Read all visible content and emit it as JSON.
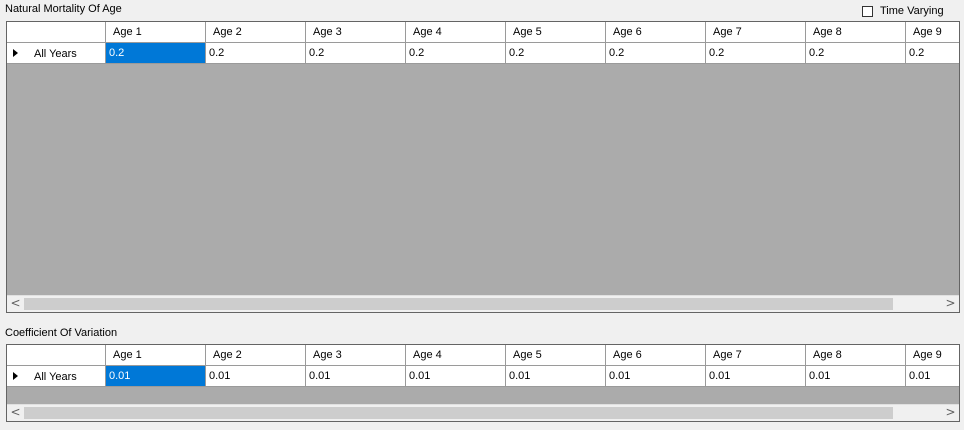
{
  "section1": {
    "title": "Natural Mortality Of Age",
    "row_label": "All Years",
    "values": [
      "0.2",
      "0.2",
      "0.2",
      "0.2",
      "0.2",
      "0.2",
      "0.2",
      "0.2",
      "0.2"
    ]
  },
  "time_varying": {
    "label": "Time Varying",
    "checked": false
  },
  "section2": {
    "title": "Coefficient Of Variation",
    "row_label": "All Years",
    "values": [
      "0.01",
      "0.01",
      "0.01",
      "0.01",
      "0.01",
      "0.01",
      "0.01",
      "0.01",
      "0.01"
    ]
  },
  "columns": [
    "Age 1",
    "Age 2",
    "Age 3",
    "Age 4",
    "Age 5",
    "Age 6",
    "Age 7",
    "Age 8",
    "Age 9"
  ],
  "scroll": {
    "left_arrow": "<",
    "right_arrow": ">"
  },
  "colors": {
    "selection": "#0078d7",
    "grid_background": "#ababab"
  },
  "icons": {
    "row_indicator": "triangle-right-icon",
    "checkbox": "checkbox-unchecked"
  }
}
